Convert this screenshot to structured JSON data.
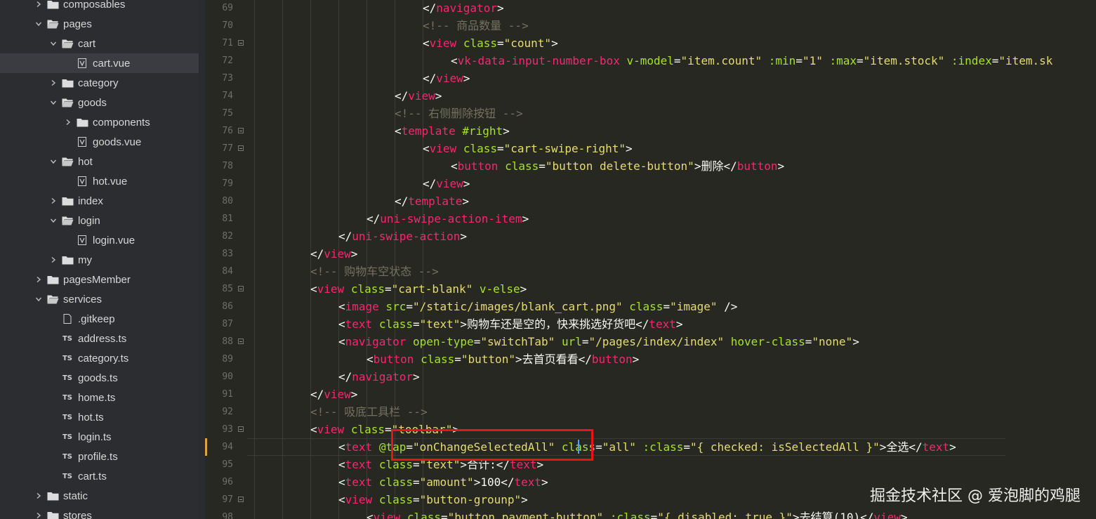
{
  "colors": {
    "accent_highlight": "#e8141a",
    "modified_marker": "#e0a33a",
    "cursor": "#4aa3ff"
  },
  "file_tree": [
    {
      "label": "composables",
      "type": "folder",
      "expanded": false
    },
    {
      "label": "pages",
      "type": "folder",
      "expanded": true
    },
    {
      "label": "cart",
      "type": "folder",
      "expanded": true
    },
    {
      "label": "cart.vue",
      "type": "vue",
      "active": true
    },
    {
      "label": "category",
      "type": "folder",
      "expanded": false
    },
    {
      "label": "goods",
      "type": "folder",
      "expanded": true
    },
    {
      "label": "components",
      "type": "folder",
      "expanded": false
    },
    {
      "label": "goods.vue",
      "type": "vue"
    },
    {
      "label": "hot",
      "type": "folder",
      "expanded": true
    },
    {
      "label": "hot.vue",
      "type": "vue"
    },
    {
      "label": "index",
      "type": "folder",
      "expanded": false
    },
    {
      "label": "login",
      "type": "folder",
      "expanded": true
    },
    {
      "label": "login.vue",
      "type": "vue"
    },
    {
      "label": "my",
      "type": "folder",
      "expanded": false
    },
    {
      "label": "pagesMember",
      "type": "folder",
      "expanded": false
    },
    {
      "label": "services",
      "type": "folder",
      "expanded": true
    },
    {
      "label": ".gitkeep",
      "type": "file"
    },
    {
      "label": "address.ts",
      "type": "ts",
      "badge": "TS"
    },
    {
      "label": "category.ts",
      "type": "ts",
      "badge": "TS"
    },
    {
      "label": "goods.ts",
      "type": "ts",
      "badge": "TS"
    },
    {
      "label": "home.ts",
      "type": "ts",
      "badge": "TS"
    },
    {
      "label": "hot.ts",
      "type": "ts",
      "badge": "TS"
    },
    {
      "label": "login.ts",
      "type": "ts",
      "badge": "TS"
    },
    {
      "label": "profile.ts",
      "type": "ts",
      "badge": "TS"
    },
    {
      "label": "cart.ts",
      "type": "ts",
      "badge": "TS"
    },
    {
      "label": "static",
      "type": "folder",
      "expanded": false
    },
    {
      "label": "stores",
      "type": "folder",
      "expanded": false
    }
  ],
  "code_lines": [
    {
      "num": "69",
      "fold": false,
      "tokens": [
        [
          "punc",
          "</"
        ],
        [
          "tag",
          "navigator"
        ],
        [
          "punc",
          ">"
        ]
      ]
    },
    {
      "num": "70",
      "fold": false,
      "tokens": [
        [
          "comment",
          "<!-- 商品数量 -->"
        ]
      ]
    },
    {
      "num": "71",
      "fold": true,
      "tokens": [
        [
          "punc",
          "<"
        ],
        [
          "tag",
          "view"
        ],
        [
          "text",
          " "
        ],
        [
          "attr",
          "class"
        ],
        [
          "punc",
          "="
        ],
        [
          "str",
          "\"count\""
        ],
        [
          "punc",
          ">"
        ]
      ]
    },
    {
      "num": "72",
      "fold": false,
      "tokens": [
        [
          "punc",
          "<"
        ],
        [
          "tag",
          "vk-data-input-number-box"
        ],
        [
          "text",
          " "
        ],
        [
          "attr",
          "v-model"
        ],
        [
          "punc",
          "="
        ],
        [
          "str",
          "\"item.count\""
        ],
        [
          "text",
          " "
        ],
        [
          "attr",
          ":min"
        ],
        [
          "punc",
          "="
        ],
        [
          "str",
          "\"1\""
        ],
        [
          "text",
          " "
        ],
        [
          "attr",
          ":max"
        ],
        [
          "punc",
          "="
        ],
        [
          "str",
          "\"item.stock\""
        ],
        [
          "text",
          " "
        ],
        [
          "attr",
          ":index"
        ],
        [
          "punc",
          "="
        ],
        [
          "str",
          "\"item.sk"
        ]
      ]
    },
    {
      "num": "73",
      "fold": false,
      "tokens": [
        [
          "punc",
          "</"
        ],
        [
          "tag",
          "view"
        ],
        [
          "punc",
          ">"
        ]
      ]
    },
    {
      "num": "74",
      "fold": false,
      "tokens": [
        [
          "punc",
          "</"
        ],
        [
          "tag",
          "view"
        ],
        [
          "punc",
          ">"
        ]
      ]
    },
    {
      "num": "75",
      "fold": false,
      "tokens": [
        [
          "comment",
          "<!-- 右侧删除按钮 -->"
        ]
      ]
    },
    {
      "num": "76",
      "fold": true,
      "tokens": [
        [
          "punc",
          "<"
        ],
        [
          "tag",
          "template"
        ],
        [
          "text",
          " "
        ],
        [
          "attr",
          "#right"
        ],
        [
          "punc",
          ">"
        ]
      ]
    },
    {
      "num": "77",
      "fold": true,
      "tokens": [
        [
          "punc",
          "<"
        ],
        [
          "tag",
          "view"
        ],
        [
          "text",
          " "
        ],
        [
          "attr",
          "class"
        ],
        [
          "punc",
          "="
        ],
        [
          "str",
          "\"cart-swipe-right\""
        ],
        [
          "punc",
          ">"
        ]
      ]
    },
    {
      "num": "78",
      "fold": false,
      "tokens": [
        [
          "punc",
          "<"
        ],
        [
          "tag",
          "button"
        ],
        [
          "text",
          " "
        ],
        [
          "attr",
          "class"
        ],
        [
          "punc",
          "="
        ],
        [
          "str",
          "\"button delete-button\""
        ],
        [
          "punc",
          ">"
        ],
        [
          "text",
          "删除"
        ],
        [
          "punc",
          "</"
        ],
        [
          "tag",
          "button"
        ],
        [
          "punc",
          ">"
        ]
      ]
    },
    {
      "num": "79",
      "fold": false,
      "tokens": [
        [
          "punc",
          "</"
        ],
        [
          "tag",
          "view"
        ],
        [
          "punc",
          ">"
        ]
      ]
    },
    {
      "num": "80",
      "fold": false,
      "tokens": [
        [
          "punc",
          "</"
        ],
        [
          "tag",
          "template"
        ],
        [
          "punc",
          ">"
        ]
      ]
    },
    {
      "num": "81",
      "fold": false,
      "tokens": [
        [
          "punc",
          "</"
        ],
        [
          "tag",
          "uni-swipe-action-item"
        ],
        [
          "punc",
          ">"
        ]
      ]
    },
    {
      "num": "82",
      "fold": false,
      "tokens": [
        [
          "punc",
          "</"
        ],
        [
          "tag",
          "uni-swipe-action"
        ],
        [
          "punc",
          ">"
        ]
      ]
    },
    {
      "num": "83",
      "fold": false,
      "tokens": [
        [
          "punc",
          "</"
        ],
        [
          "tag",
          "view"
        ],
        [
          "punc",
          ">"
        ]
      ]
    },
    {
      "num": "84",
      "fold": false,
      "tokens": [
        [
          "comment",
          "<!-- 购物车空状态 -->"
        ]
      ]
    },
    {
      "num": "85",
      "fold": true,
      "tokens": [
        [
          "punc",
          "<"
        ],
        [
          "tag",
          "view"
        ],
        [
          "text",
          " "
        ],
        [
          "attr",
          "class"
        ],
        [
          "punc",
          "="
        ],
        [
          "str",
          "\"cart-blank\""
        ],
        [
          "text",
          " "
        ],
        [
          "attr",
          "v-else"
        ],
        [
          "punc",
          ">"
        ]
      ]
    },
    {
      "num": "86",
      "fold": false,
      "tokens": [
        [
          "punc",
          "<"
        ],
        [
          "tag",
          "image"
        ],
        [
          "text",
          " "
        ],
        [
          "attr",
          "src"
        ],
        [
          "punc",
          "="
        ],
        [
          "str",
          "\"/static/images/blank_cart.png\""
        ],
        [
          "text",
          " "
        ],
        [
          "attr",
          "class"
        ],
        [
          "punc",
          "="
        ],
        [
          "str",
          "\"image\""
        ],
        [
          "text",
          " "
        ],
        [
          "punc",
          "/>"
        ]
      ]
    },
    {
      "num": "87",
      "fold": false,
      "tokens": [
        [
          "punc",
          "<"
        ],
        [
          "tag",
          "text"
        ],
        [
          "text",
          " "
        ],
        [
          "attr",
          "class"
        ],
        [
          "punc",
          "="
        ],
        [
          "str",
          "\"text\""
        ],
        [
          "punc",
          ">"
        ],
        [
          "text",
          "购物车还是空的，快来挑选好货吧"
        ],
        [
          "punc",
          "</"
        ],
        [
          "tag",
          "text"
        ],
        [
          "punc",
          ">"
        ]
      ]
    },
    {
      "num": "88",
      "fold": true,
      "tokens": [
        [
          "punc",
          "<"
        ],
        [
          "tag",
          "navigator"
        ],
        [
          "text",
          " "
        ],
        [
          "attr",
          "open-type"
        ],
        [
          "punc",
          "="
        ],
        [
          "str",
          "\"switchTab\""
        ],
        [
          "text",
          " "
        ],
        [
          "attr",
          "url"
        ],
        [
          "punc",
          "="
        ],
        [
          "str",
          "\"/pages/index/index\""
        ],
        [
          "text",
          " "
        ],
        [
          "attr",
          "hover-class"
        ],
        [
          "punc",
          "="
        ],
        [
          "str",
          "\"none\""
        ],
        [
          "punc",
          ">"
        ]
      ]
    },
    {
      "num": "89",
      "fold": false,
      "tokens": [
        [
          "punc",
          "<"
        ],
        [
          "tag",
          "button"
        ],
        [
          "text",
          " "
        ],
        [
          "attr",
          "class"
        ],
        [
          "punc",
          "="
        ],
        [
          "str",
          "\"button\""
        ],
        [
          "punc",
          ">"
        ],
        [
          "text",
          "去首页看看"
        ],
        [
          "punc",
          "</"
        ],
        [
          "tag",
          "button"
        ],
        [
          "punc",
          ">"
        ]
      ]
    },
    {
      "num": "90",
      "fold": false,
      "tokens": [
        [
          "punc",
          "</"
        ],
        [
          "tag",
          "navigator"
        ],
        [
          "punc",
          ">"
        ]
      ]
    },
    {
      "num": "91",
      "fold": false,
      "tokens": [
        [
          "punc",
          "</"
        ],
        [
          "tag",
          "view"
        ],
        [
          "punc",
          ">"
        ]
      ]
    },
    {
      "num": "92",
      "fold": false,
      "tokens": [
        [
          "comment",
          "<!-- 吸底工具栏 -->"
        ]
      ]
    },
    {
      "num": "93",
      "fold": true,
      "tokens": [
        [
          "punc",
          "<"
        ],
        [
          "tag",
          "view"
        ],
        [
          "text",
          " "
        ],
        [
          "attr",
          "class"
        ],
        [
          "punc",
          "="
        ],
        [
          "str",
          "\"toolbar\""
        ],
        [
          "punc",
          ">"
        ]
      ]
    },
    {
      "num": "94",
      "fold": false,
      "tokens": [
        [
          "punc",
          "<"
        ],
        [
          "tag",
          "text"
        ],
        [
          "text",
          " "
        ],
        [
          "attr",
          "@tap"
        ],
        [
          "punc",
          "="
        ],
        [
          "str",
          "\"onChangeSelectedAll\""
        ],
        [
          "text",
          " "
        ],
        [
          "attr",
          "class"
        ],
        [
          "punc",
          "="
        ],
        [
          "str",
          "\"all\""
        ],
        [
          "text",
          " "
        ],
        [
          "attr",
          ":class"
        ],
        [
          "punc",
          "="
        ],
        [
          "str",
          "\"{ checked: isSelectedAll }\""
        ],
        [
          "punc",
          ">"
        ],
        [
          "text",
          "全选"
        ],
        [
          "punc",
          "</"
        ],
        [
          "tag",
          "text"
        ],
        [
          "punc",
          ">"
        ]
      ]
    },
    {
      "num": "95",
      "fold": false,
      "tokens": [
        [
          "punc",
          "<"
        ],
        [
          "tag",
          "text"
        ],
        [
          "text",
          " "
        ],
        [
          "attr",
          "class"
        ],
        [
          "punc",
          "="
        ],
        [
          "str",
          "\"text\""
        ],
        [
          "punc",
          ">"
        ],
        [
          "text",
          "合计:"
        ],
        [
          "punc",
          "</"
        ],
        [
          "tag",
          "text"
        ],
        [
          "punc",
          ">"
        ]
      ]
    },
    {
      "num": "96",
      "fold": false,
      "tokens": [
        [
          "punc",
          "<"
        ],
        [
          "tag",
          "text"
        ],
        [
          "text",
          " "
        ],
        [
          "attr",
          "class"
        ],
        [
          "punc",
          "="
        ],
        [
          "str",
          "\"amount\""
        ],
        [
          "punc",
          ">"
        ],
        [
          "text",
          "100"
        ],
        [
          "punc",
          "</"
        ],
        [
          "tag",
          "text"
        ],
        [
          "punc",
          ">"
        ]
      ]
    },
    {
      "num": "97",
      "fold": true,
      "tokens": [
        [
          "punc",
          "<"
        ],
        [
          "tag",
          "view"
        ],
        [
          "text",
          " "
        ],
        [
          "attr",
          "class"
        ],
        [
          "punc",
          "="
        ],
        [
          "str",
          "\"button-grounp\""
        ],
        [
          "punc",
          ">"
        ]
      ]
    },
    {
      "num": "98",
      "fold": false,
      "tokens": [
        [
          "punc",
          "<"
        ],
        [
          "tag",
          "view"
        ],
        [
          "text",
          " "
        ],
        [
          "attr",
          "class"
        ],
        [
          "punc",
          "="
        ],
        [
          "str",
          "\"button payment-button\""
        ],
        [
          "text",
          " "
        ],
        [
          "attr",
          ":class"
        ],
        [
          "punc",
          "="
        ],
        [
          "str",
          "\"{ disabled: true }\""
        ],
        [
          "punc",
          ">"
        ],
        [
          "text",
          "去结算(10)"
        ],
        [
          "punc",
          "</"
        ],
        [
          "tag",
          "view"
        ],
        [
          "punc",
          ">"
        ]
      ]
    }
  ],
  "watermark": "掘金技术社区 @ 爱泡脚的鸡腿"
}
